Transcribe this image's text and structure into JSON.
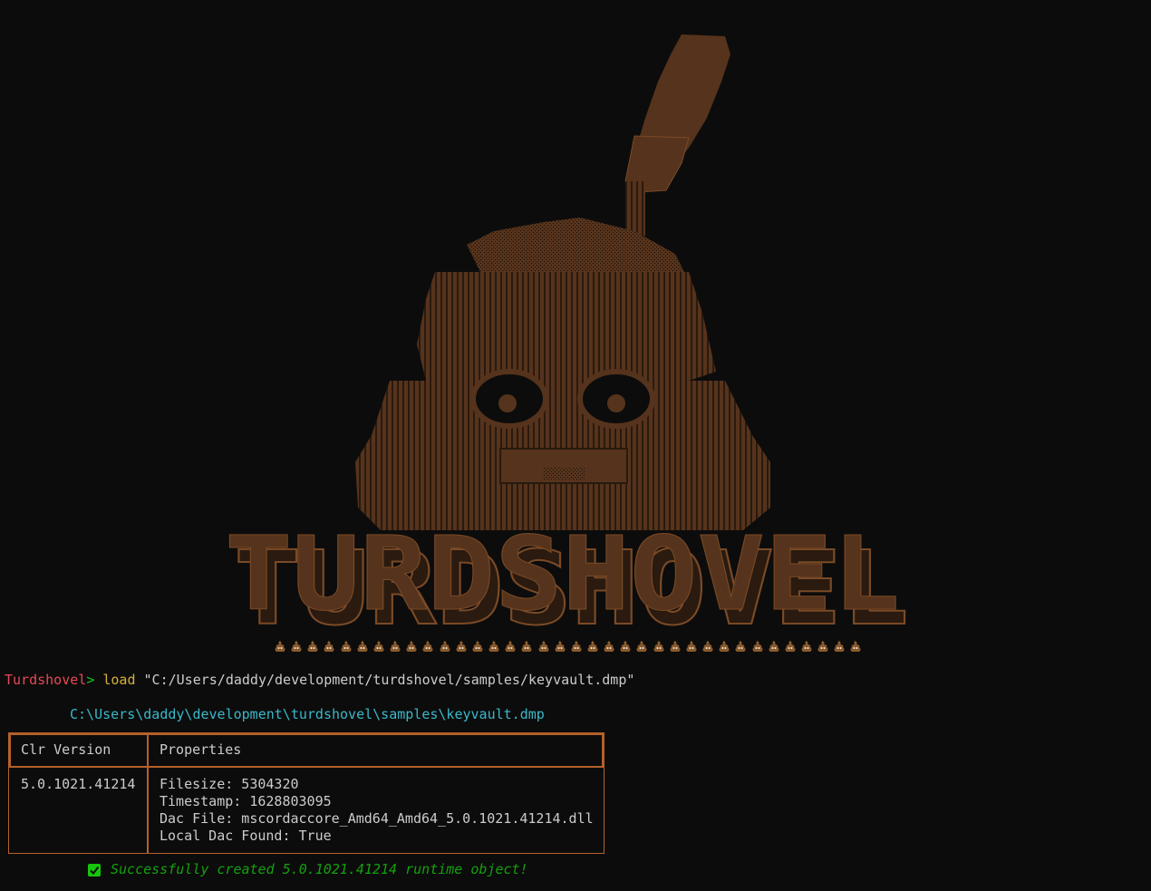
{
  "banner": {
    "logo_text": "TURDSHOVEL",
    "colors": {
      "fill": "#56331c",
      "outline": "#7a4a26",
      "shade": "#2a1a0f"
    },
    "poo_icon_count": 36,
    "poo_icon": "pile-of-poo-icon"
  },
  "prompt": {
    "name": "Turdshovel",
    "symbol": "> ",
    "command": "load",
    "argument": " \"C:/Users/daddy/development/turdshovel/samples/keyvault.dmp\""
  },
  "loaded_path": "C:\\Users\\daddy\\development\\turdshovel\\samples\\keyvault.dmp",
  "table": {
    "headers": {
      "clr_version": "Clr Version",
      "properties": "Properties"
    },
    "row": {
      "clr_version": "5.0.1021.41214",
      "filesize": "Filesize: 5304320",
      "timestamp": "Timestamp: 1628803095",
      "dac_file": "Dac File: mscordaccore_Amd64_Amd64_5.0.1021.41214.dll",
      "local_dac_found": "Local Dac Found: True"
    },
    "border_color": "#b5602a"
  },
  "status": {
    "icon": "check-mark-icon",
    "message": "Successfully created 5.0.1021.41214 runtime object!",
    "color": "#13a10e"
  }
}
